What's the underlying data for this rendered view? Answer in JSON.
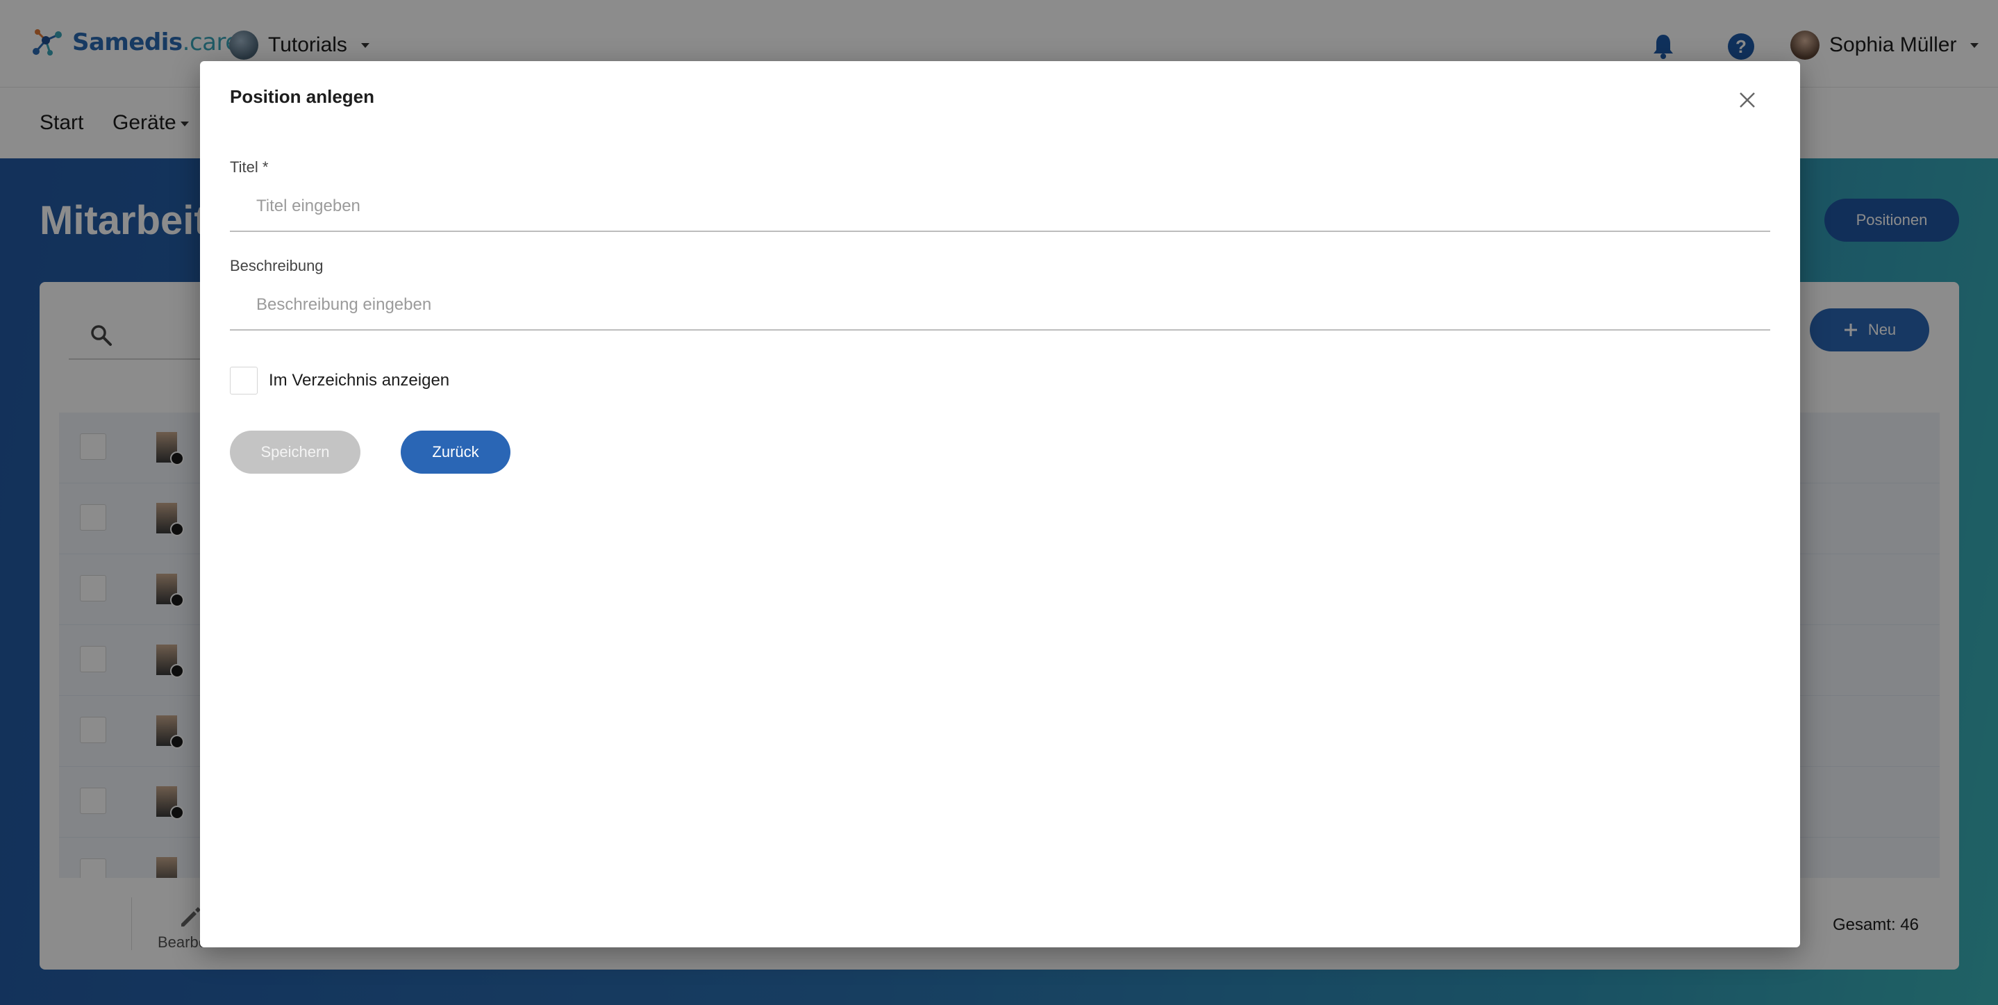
{
  "app": {
    "logo_text": "Samedis",
    "logo_suffix": ".care",
    "tenant": "Tutorials",
    "user_name": "Sophia Müller"
  },
  "nav": {
    "items": [
      "Start",
      "Geräte"
    ]
  },
  "page": {
    "title": "Mitarbeiter",
    "positionen_button": "Positionen",
    "new_button": "Neu",
    "edit_label": "Bearbeiten",
    "total_label": "Gesamt: 46"
  },
  "modal": {
    "title": "Position anlegen",
    "title_field": {
      "label": "Titel *",
      "placeholder": "Titel eingeben",
      "value": ""
    },
    "description_field": {
      "label": "Beschreibung",
      "placeholder": "Beschreibung eingeben",
      "value": ""
    },
    "directory_checkbox": {
      "label": "Im Verzeichnis anzeigen",
      "checked": false
    },
    "save_button": "Speichern",
    "back_button": "Zurück"
  },
  "colors": {
    "primary": "#2a66b5",
    "disabled": "#c4c4c4",
    "brand": "#2a6ab3",
    "header_gradient_start": "#2359a4",
    "header_gradient_end": "#3bb3b8"
  },
  "icons": [
    "samedis-logo-icon",
    "tenant-icon",
    "bell-icon",
    "help-icon",
    "user-avatar-icon",
    "search-icon",
    "plus-icon",
    "edit-icon",
    "close-icon"
  ]
}
